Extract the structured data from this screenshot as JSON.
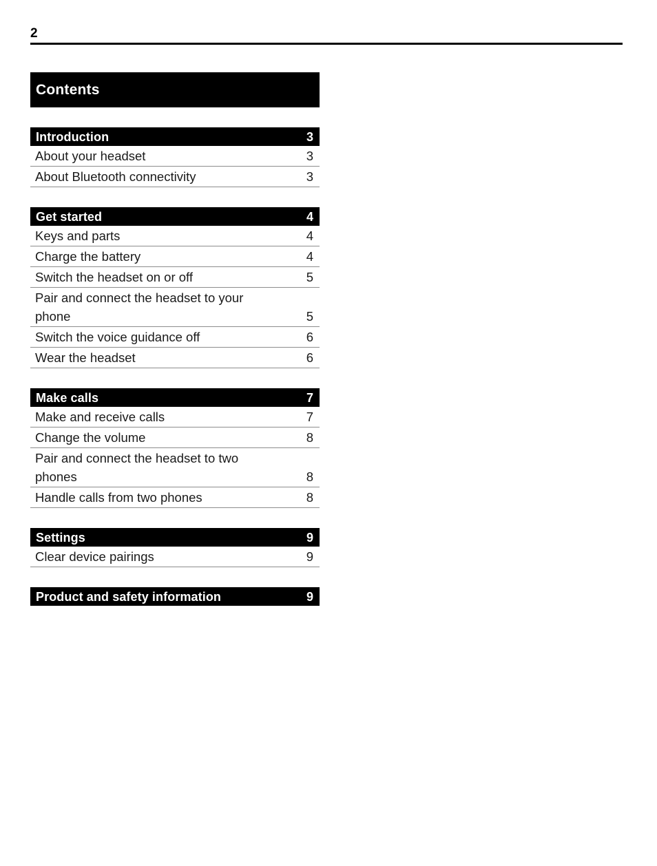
{
  "page": {
    "number": "2"
  },
  "toc": {
    "title": "Contents",
    "sections": [
      {
        "label": "Introduction",
        "page": "3",
        "entries": [
          {
            "label": "About your headset",
            "page": "3",
            "lines": [
              "About your headset"
            ]
          },
          {
            "label": "About Bluetooth connectivity",
            "page": "3",
            "lines": [
              "About Bluetooth connectivity"
            ]
          }
        ]
      },
      {
        "label": "Get started",
        "page": "4",
        "entries": [
          {
            "label": "Keys and parts",
            "page": "4",
            "lines": [
              "Keys and parts"
            ]
          },
          {
            "label": "Charge the battery",
            "page": "4",
            "lines": [
              "Charge the battery"
            ]
          },
          {
            "label": "Switch the headset on or off",
            "page": "5",
            "lines": [
              "Switch the headset on or off"
            ]
          },
          {
            "label": "Pair and connect the headset to your phone",
            "page": "5",
            "lines": [
              "Pair and connect the headset to your",
              "phone"
            ]
          },
          {
            "label": "Switch the voice guidance off",
            "page": "6",
            "lines": [
              "Switch the voice guidance off"
            ]
          },
          {
            "label": "Wear the headset",
            "page": "6",
            "lines": [
              "Wear the headset"
            ]
          }
        ]
      },
      {
        "label": "Make calls",
        "page": "7",
        "entries": [
          {
            "label": "Make and receive calls",
            "page": "7",
            "lines": [
              "Make and receive calls"
            ]
          },
          {
            "label": "Change the volume",
            "page": "8",
            "lines": [
              "Change the volume"
            ]
          },
          {
            "label": "Pair and connect the headset to two phones",
            "page": "8",
            "lines": [
              "Pair and connect the headset to two",
              "phones"
            ]
          },
          {
            "label": "Handle calls from two phones",
            "page": "8",
            "lines": [
              "Handle calls from two phones"
            ]
          }
        ]
      },
      {
        "label": "Settings",
        "page": "9",
        "entries": [
          {
            "label": "Clear device pairings",
            "page": "9",
            "lines": [
              "Clear device pairings"
            ]
          }
        ]
      },
      {
        "label": "Product and safety information",
        "page": "9",
        "entries": []
      }
    ]
  },
  "colors": {
    "bar_background": "#000000",
    "bar_text": "#ffffff",
    "body_text": "#1a1a1a",
    "rule": "#8c8c8c",
    "page_background": "#ffffff"
  }
}
